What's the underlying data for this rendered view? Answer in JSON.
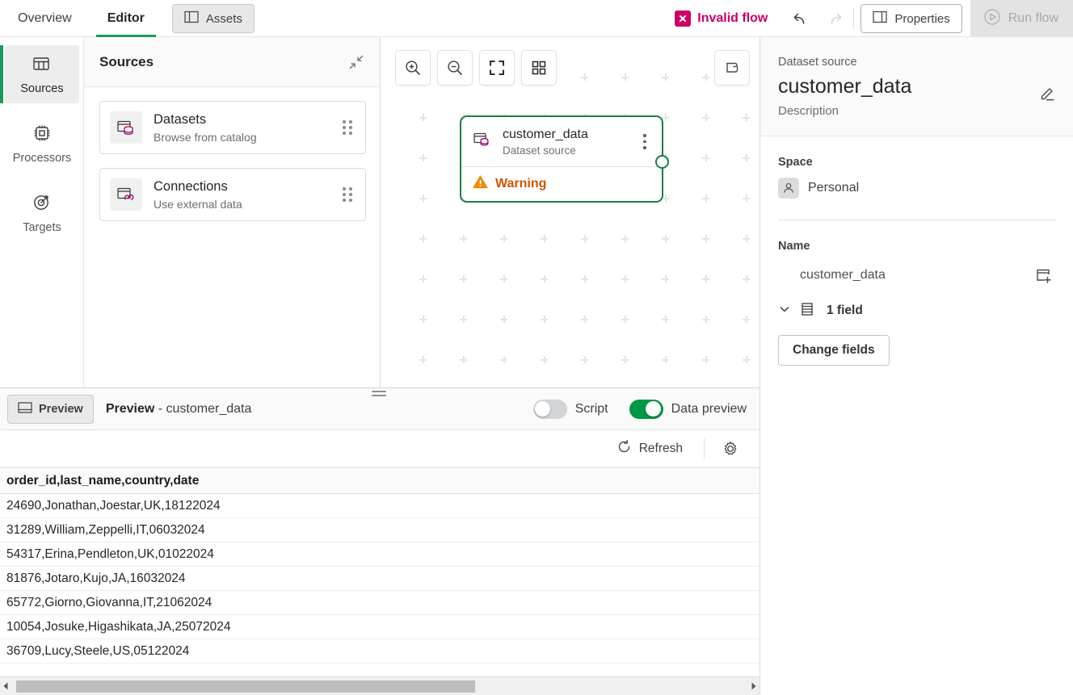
{
  "topbar": {
    "tabs": [
      {
        "label": "Overview",
        "active": false
      },
      {
        "label": "Editor",
        "active": true
      }
    ],
    "assets_label": "Assets",
    "invalid_flow_label": "Invalid flow",
    "invalid_flow_color": "#cc0066",
    "properties_label": "Properties",
    "run_flow_label": "Run flow",
    "undo_title": "Undo",
    "redo_title": "Redo"
  },
  "rail": {
    "items": [
      {
        "label": "Sources",
        "icon": "table-icon",
        "active": true
      },
      {
        "label": "Processors",
        "icon": "chip-icon",
        "active": false
      },
      {
        "label": "Targets",
        "icon": "target-icon",
        "active": false
      }
    ],
    "accent_color": "#1a9b5a"
  },
  "sources": {
    "title": "Sources",
    "collapse_icon": "collapse-icon",
    "cards": [
      {
        "title": "Datasets",
        "subtitle": "Browse from catalog",
        "icon": "dataset-icon"
      },
      {
        "title": "Connections",
        "subtitle": "Use external data",
        "icon": "connection-icon"
      }
    ]
  },
  "canvas": {
    "tools": [
      {
        "name": "zoom-in-icon",
        "title": "Zoom in"
      },
      {
        "name": "zoom-out-icon",
        "title": "Zoom out"
      },
      {
        "name": "fit-screen-icon",
        "title": "Fit to screen"
      },
      {
        "name": "layout-grid-icon",
        "title": "Auto layout"
      }
    ],
    "script_tool": {
      "name": "script-icon",
      "title": "Script"
    },
    "node": {
      "title": "customer_data",
      "subtitle": "Dataset source",
      "status": "Warning",
      "status_color": "#cc5500",
      "border_color": "#1a7d46",
      "selected": true
    }
  },
  "properties": {
    "kicker": "Dataset source",
    "title": "customer_data",
    "description_placeholder": "Description",
    "edit_icon": "pencil-icon",
    "space_label": "Space",
    "space_value": "Personal",
    "name_label": "Name",
    "name_value": "customer_data",
    "add_table_icon": "add-table-icon",
    "fields_count_label": "1 field",
    "change_fields_label": "Change fields"
  },
  "preview": {
    "toggle_button_label": "Preview",
    "title_bold": "Preview",
    "title_rest": " - customer_data",
    "script_toggle": {
      "label": "Script",
      "on": false
    },
    "data_preview_toggle": {
      "label": "Data preview",
      "on": true,
      "color": "#009845"
    },
    "refresh_label": "Refresh",
    "settings_icon": "gear-icon",
    "table": {
      "header": "order_id,last_name,country,date",
      "rows": [
        "24690,Jonathan,Joestar,UK,18122024",
        "31289,William,Zeppelli,IT,06032024",
        "54317,Erina,Pendleton,UK,01022024",
        "81876,Jotaro,Kujo,JA,16032024",
        "65772,Giorno,Giovanna,IT,21062024",
        "10054,Josuke,Higashikata,JA,25072024",
        "36709,Lucy,Steele,US,05122024"
      ]
    }
  }
}
